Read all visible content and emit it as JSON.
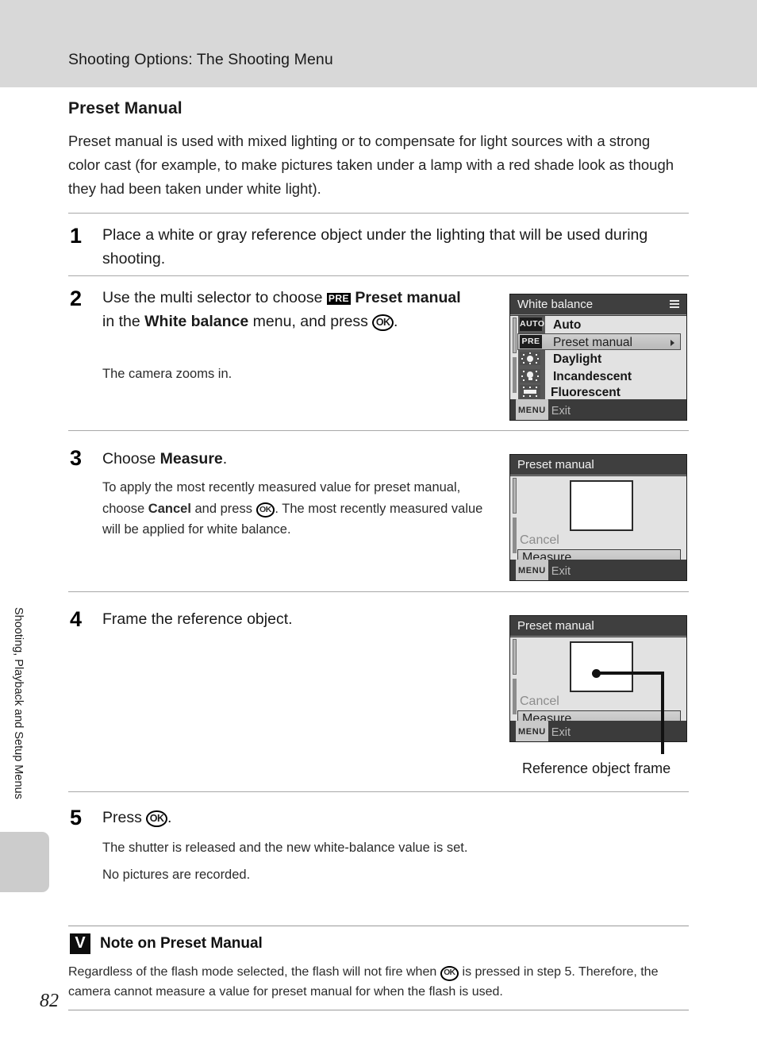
{
  "header": {
    "running_title": "Shooting Options: The Shooting Menu"
  },
  "side_tab": {
    "label": "Shooting, Playback and Setup Menus"
  },
  "page_number": "82",
  "section": {
    "title": "Preset Manual",
    "intro": "Preset manual is used with mixed lighting or to compensate for light sources with a strong color cast (for example, to make pictures taken under a lamp with a red shade look as though they had been taken under white light)."
  },
  "steps": [
    {
      "number": "1",
      "heading_html": "Place a white or gray reference object under the lighting that will be used during shooting.",
      "body_html": ""
    },
    {
      "number": "2",
      "heading_pre_glyph": "PRE",
      "heading_ok_glyph": "OK",
      "body_html": "The camera zooms in."
    },
    {
      "number": "3",
      "heading_html": "Choose <b>Measure</b>.",
      "body_html": ""
    },
    {
      "number": "4",
      "heading_html": "Frame the reference object.",
      "body_html": ""
    },
    {
      "number": "5",
      "heading_html": "Press",
      "body_line1": "The shutter is released and the new white-balance value is set.",
      "body_line2": "No pictures are recorded."
    }
  ],
  "lcd_white_balance": {
    "title": "White balance",
    "menu_icon": "hamburger-icon",
    "rows": [
      {
        "icon": "auto-wb-icon",
        "icon_text": "AUTO",
        "label": "Auto",
        "selected": false
      },
      {
        "icon": "preset-manual-wb-icon",
        "icon_text": "PRE",
        "label": "Preset manual",
        "selected": true
      },
      {
        "icon": "daylight-wb-icon",
        "icon_text": "",
        "label": "Daylight",
        "selected": false
      },
      {
        "icon": "incandescent-wb-icon",
        "icon_text": "",
        "label": "Incandescent",
        "selected": false
      },
      {
        "icon": "fluorescent-wb-icon",
        "icon_text": "",
        "label": "Fluorescent",
        "selected": false
      }
    ],
    "footer_tag": "MENU",
    "footer_label": "Exit"
  },
  "lcd_preset_manual_step3": {
    "title": "Preset manual",
    "cancel_label": "Cancel",
    "measure_label": "Measure",
    "footer_tag": "MENU",
    "footer_label": "Exit"
  },
  "lcd_preset_manual_step4": {
    "title": "Preset manual",
    "cancel_label": "Cancel",
    "measure_label": "Measure",
    "footer_tag": "MENU",
    "footer_label": "Exit"
  },
  "callout": {
    "label": "Reference object frame"
  },
  "note": {
    "icon": "warning-check-icon",
    "icon_glyph": "V",
    "title": "Note on Preset Manual",
    "body_part1": "Regardless of the flash mode selected, the flash will not fire when",
    "body_part2": "is pressed in step 5. Therefore, the camera cannot measure a value for preset manual for when the flash is used."
  }
}
